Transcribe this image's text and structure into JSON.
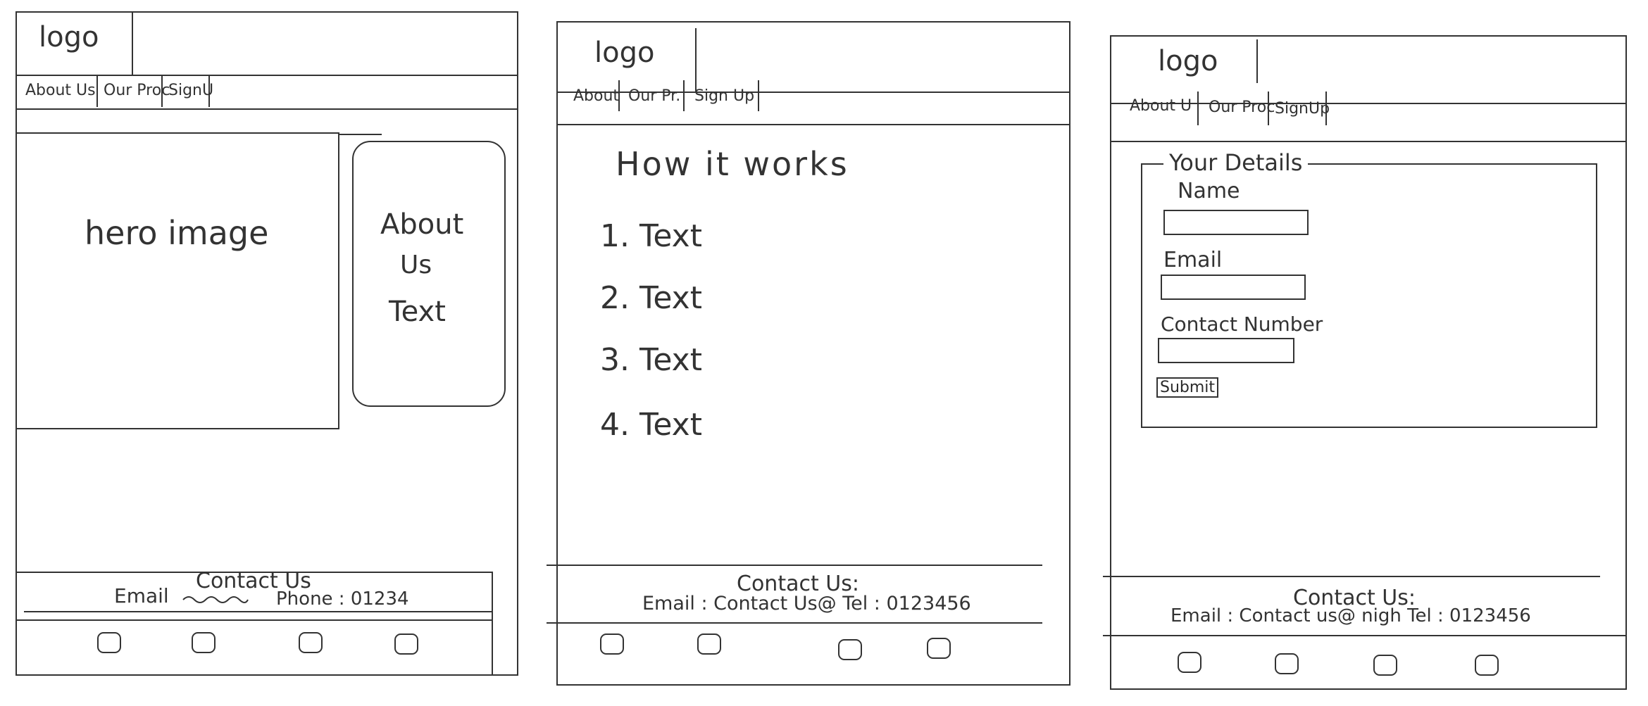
{
  "wireframes": [
    {
      "logo": "logo",
      "nav": [
        "About Us",
        "Our Proc",
        "SignU"
      ],
      "hero": "hero image",
      "about": [
        "About",
        "Us",
        "Text"
      ],
      "footer": {
        "title": "Contact Us",
        "email_label": "Email",
        "phone": "Phone : 01234"
      },
      "footer_icons": [
        "square-icon",
        "square-icon",
        "square-icon",
        "square-icon"
      ]
    },
    {
      "logo": "logo",
      "nav": [
        "About",
        "Our Pr.",
        "Sign Up"
      ],
      "heading": "How it works",
      "steps": [
        "1.  Text",
        "2.  Text",
        "3.  Text",
        "4.  Text"
      ],
      "footer": {
        "title": "Contact Us:",
        "contact": "Email : Contact Us@   Tel : 0123456"
      },
      "footer_icons": [
        "square-icon",
        "square-icon",
        "square-icon",
        "square-icon"
      ]
    },
    {
      "logo": "logo",
      "nav": [
        "About U",
        "Our Proc",
        "SignUp"
      ],
      "form": {
        "legend": "Your Details",
        "name_label": "Name",
        "email_label": "Email",
        "contact_label": "Contact Number",
        "submit": "Submit"
      },
      "footer": {
        "title": "Contact Us:",
        "contact": "Email : Contact us@ nigh Tel : 0123456"
      },
      "footer_icons": [
        "square-icon",
        "square-icon",
        "square-icon",
        "square-icon"
      ]
    }
  ]
}
